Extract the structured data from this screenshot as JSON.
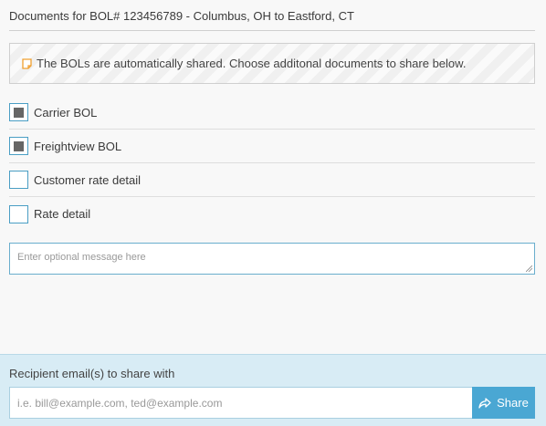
{
  "header": {
    "title": "Documents for BOL# 123456789 - Columbus, OH to Eastford, CT"
  },
  "notice": {
    "icon": "note-icon",
    "text": "The BOLs are automatically shared. Choose additonal documents to share below."
  },
  "documents": [
    {
      "label": "Carrier BOL",
      "checked": true
    },
    {
      "label": "Freightview BOL",
      "checked": true
    },
    {
      "label": "Customer rate detail",
      "checked": false
    },
    {
      "label": "Rate detail",
      "checked": false
    }
  ],
  "message": {
    "placeholder": "Enter optional message here",
    "value": ""
  },
  "share": {
    "label": "Recipient email(s) to share with",
    "email_placeholder": "i.e. bill@example.com, ted@example.com",
    "button_label": "Share",
    "button_icon": "share-icon"
  },
  "colors": {
    "accent": "#4aa7d3",
    "footer_bg": "#d8ecf5",
    "note_icon": "#f0a030"
  }
}
